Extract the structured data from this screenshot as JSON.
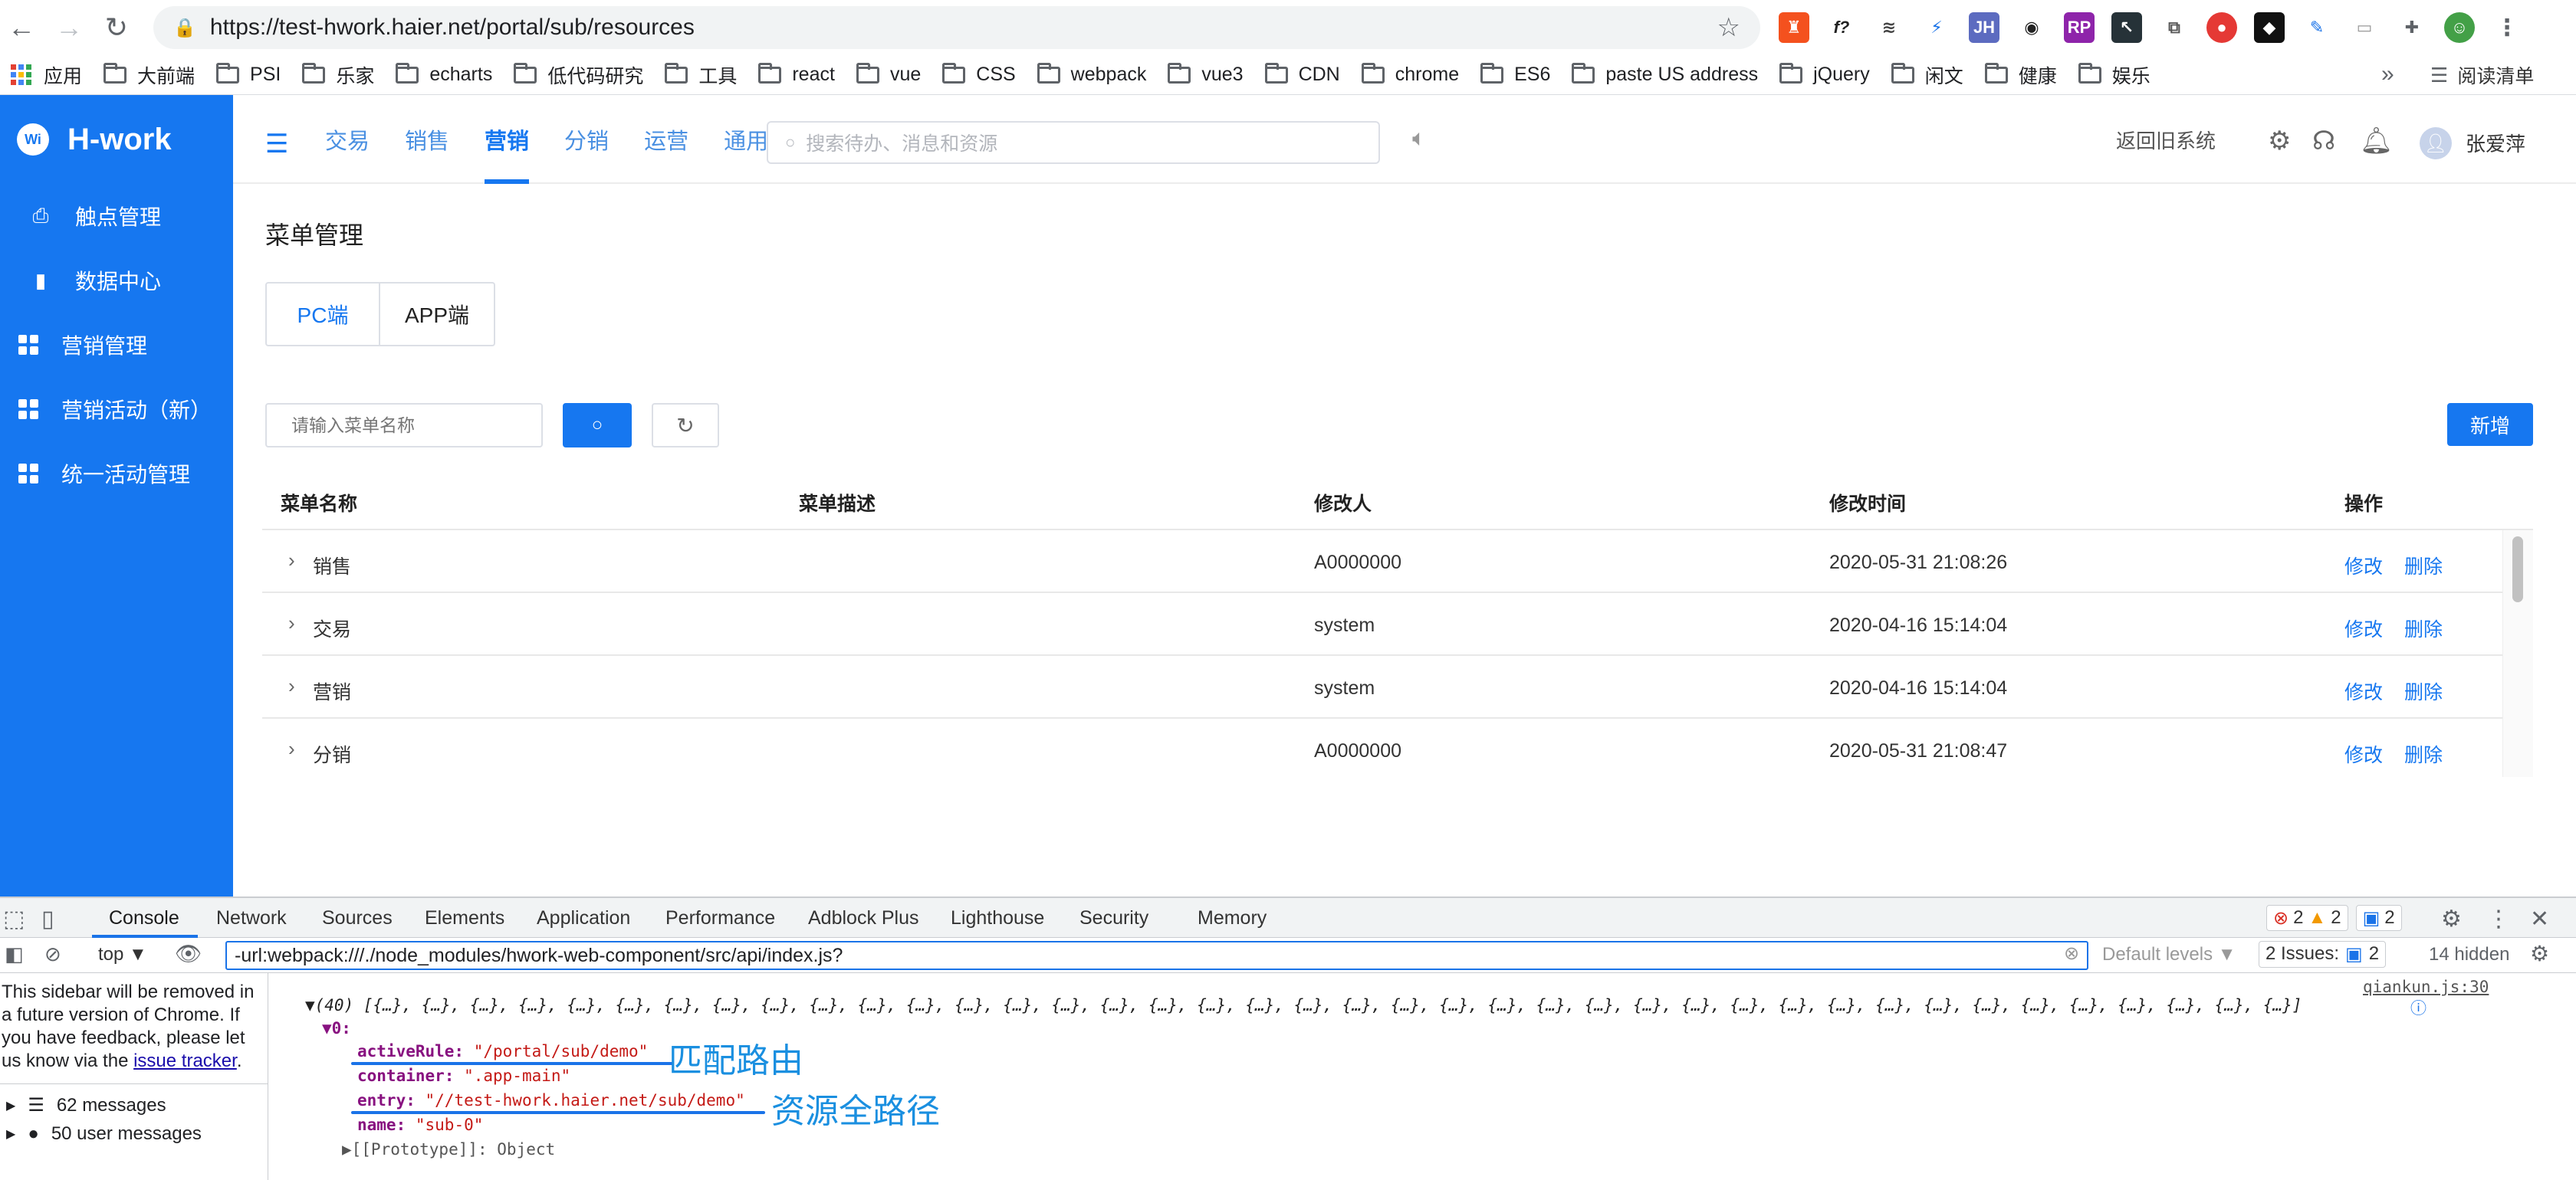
{
  "browser": {
    "url": "https://test-hwork.haier.net/portal/sub/resources",
    "bookmarks": [
      "应用",
      "大前端",
      "PSI",
      "乐家",
      "echarts",
      "低代码研究",
      "工具",
      "react",
      "vue",
      "CSS",
      "webpack",
      "vue3",
      "CDN",
      "chrome",
      "ES6",
      "paste US address",
      "jQuery",
      "闲文",
      "健康",
      "娱乐"
    ],
    "more": "»",
    "reading_list": "阅读清单"
  },
  "app": {
    "logo": "H-work",
    "logo_mark": "Wi",
    "top_tabs": [
      "交易",
      "销售",
      "营销",
      "分销",
      "运营",
      "通用"
    ],
    "active_tab": "营销",
    "search_placeholder": "搜索待办、消息和资源",
    "old_system": "返回旧系统",
    "user_name": "张爱萍",
    "sidebar": [
      "触点管理",
      "数据中心",
      "营销管理",
      "营销活动（新）",
      "统一活动管理"
    ]
  },
  "page": {
    "title": "菜单管理",
    "seg_tabs": [
      "PC端",
      "APP端"
    ],
    "menu_search_placeholder": "请输入菜单名称",
    "add_button": "新增",
    "columns": [
      "菜单名称",
      "菜单描述",
      "修改人",
      "修改时间",
      "操作"
    ],
    "rows": [
      {
        "name": "销售",
        "desc": "",
        "modifier": "A0000000",
        "time": "2020-05-31 21:08:26",
        "edit": "修改",
        "delete": "删除"
      },
      {
        "name": "交易",
        "desc": "",
        "modifier": "system",
        "time": "2020-04-16 15:14:04",
        "edit": "修改",
        "delete": "删除"
      },
      {
        "name": "营销",
        "desc": "",
        "modifier": "system",
        "time": "2020-04-16 15:14:04",
        "edit": "修改",
        "delete": "删除"
      },
      {
        "name": "分销",
        "desc": "",
        "modifier": "A0000000",
        "time": "2020-05-31 21:08:47",
        "edit": "修改",
        "delete": "删除"
      }
    ]
  },
  "devtools": {
    "tabs": [
      "Console",
      "Network",
      "Sources",
      "Elements",
      "Application",
      "Performance",
      "Adblock Plus",
      "Lighthouse",
      "Security",
      "Memory"
    ],
    "active_tab": "Console",
    "errors": "2",
    "warnings": "2",
    "infos": "2",
    "context": "top ▼",
    "filter": "-url:webpack:///./node_modules/hwork-web-component/src/api/index.js?",
    "levels": "Default levels ▼",
    "issues_label": "2 Issues:",
    "issues_count": "2",
    "hidden": "14 hidden",
    "sidebar_note": "This sidebar will be removed in a future version of Chrome. If you have feedback, please let us know via the",
    "sidebar_link": "issue tracker",
    "messages": "62 messages",
    "user_messages": "50 user messages",
    "source_link": "qiankun.js:30",
    "array_line": "▼(40) [{…}, {…}, {…}, {…}, {…}, {…}, {…}, {…}, {…}, {…}, {…}, {…}, {…}, {…}, {…}, {…}, {…}, {…}, {…}, {…}, {…}, {…}, {…}, {…}, {…}, {…}, {…}, {…}, {…}, {…}, {…}, {…}, {…}, {…}, {…}, {…}, {…}, {…}, {…}, {…}]",
    "index": "▼0:",
    "active_rule_key": "activeRule:",
    "active_rule_val": "\"/portal/sub/demo\"",
    "container_key": "container:",
    "container_val": "\".app-main\"",
    "entry_key": "entry:",
    "entry_val": "\"//test-hwork.haier.net/sub/demo\"",
    "name_key": "name:",
    "name_val": "\"sub-0\"",
    "proto": "▶[[Prototype]]: Object",
    "annotation_1": "匹配路由",
    "annotation_2": "资源全路径"
  }
}
